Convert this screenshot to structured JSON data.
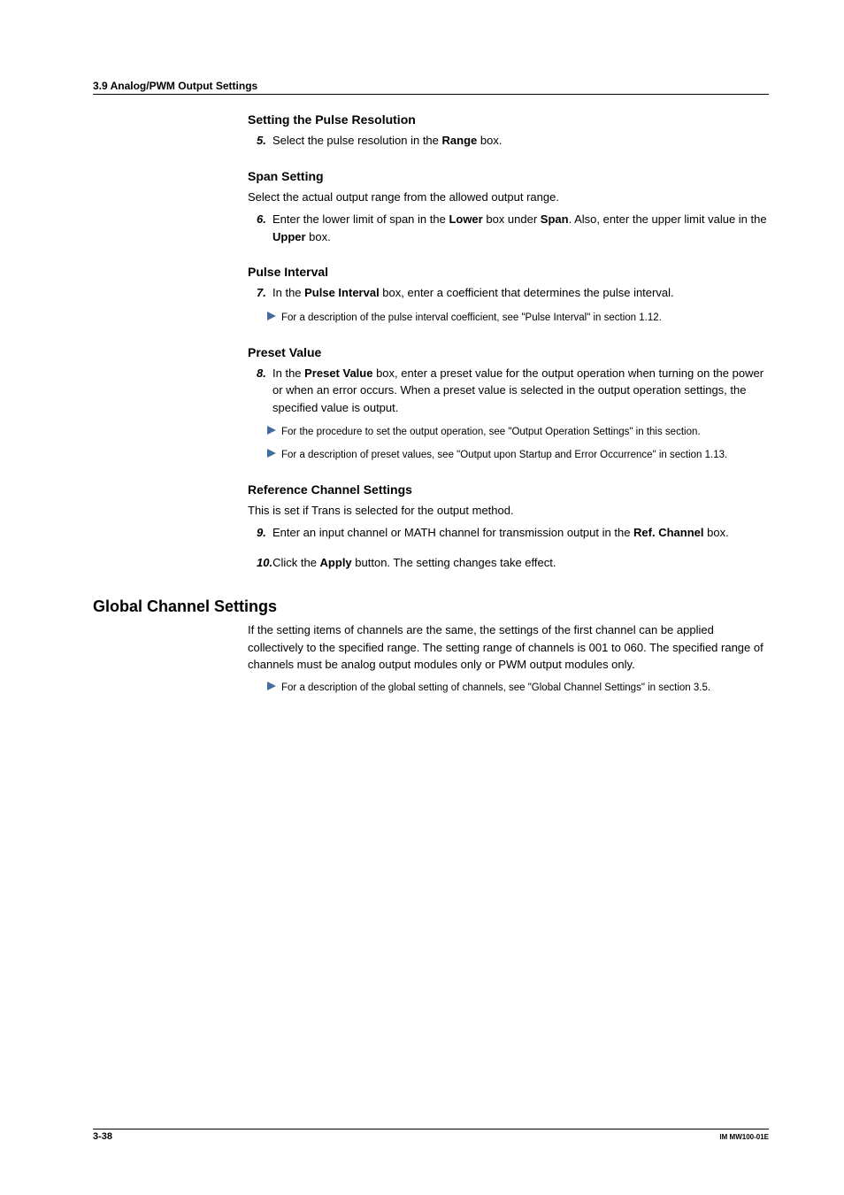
{
  "header": {
    "section_label": "3.9  Analog/PWM Output Settings"
  },
  "pulse_resolution": {
    "heading": "Setting the Pulse Resolution",
    "step_num": "5.",
    "step_text_1": "Select the pulse resolution in the ",
    "step_bold_1": "Range",
    "step_text_2": " box."
  },
  "span_setting": {
    "heading": "Span Setting",
    "intro": "Select the actual output range from the allowed output range.",
    "step_num": "6.",
    "step_text_1": "Enter the lower limit of span in the ",
    "step_bold_1": "Lower",
    "step_text_2": " box under ",
    "step_bold_2": "Span",
    "step_text_3": ". Also, enter the upper limit value in the ",
    "step_bold_3": "Upper",
    "step_text_4": " box."
  },
  "pulse_interval": {
    "heading": "Pulse Interval",
    "step_num": "7.",
    "step_text_1": "In the ",
    "step_bold_1": "Pulse Interval",
    "step_text_2": " box, enter a coefficient that determines the pulse interval.",
    "note_1": "For a description of the pulse interval coefficient, see \"Pulse Interval\" in section 1.12."
  },
  "preset_value": {
    "heading": "Preset Value",
    "step_num": "8.",
    "step_text_1": "In the ",
    "step_bold_1": "Preset Value",
    "step_text_2": " box, enter a preset value for the output operation when turning on the power or when an error occurs. When a preset value is selected in the output operation settings, the specified value is output.",
    "note_1": "For the procedure to set the output operation, see \"Output Operation Settings\" in this section.",
    "note_2": "For a description of preset values, see \"Output upon Startup and Error Occurrence\" in section 1.13."
  },
  "reference_channel": {
    "heading": "Reference Channel Settings",
    "intro": "This is set if Trans is selected for the output method.",
    "step_num_9": "9.",
    "step9_text_1": "Enter an input channel or MATH channel for transmission output in the ",
    "step9_bold_1": "Ref. Channel",
    "step9_text_2": " box.",
    "step_num_10": "10.",
    "step10_text_1": "Click the ",
    "step10_bold_1": "Apply",
    "step10_text_2": " button. The setting changes take effect."
  },
  "global_channel": {
    "heading": "Global Channel Settings",
    "intro": "If the setting items of channels are the same, the settings of the first channel can be applied collectively to the specified range. The setting range of channels is 001 to 060. The specified range of channels must be analog output modules only or PWM output modules only.",
    "note_1": "For a description of the global setting of channels, see \"Global Channel Settings\" in section 3.5."
  },
  "footer": {
    "page": "3-38",
    "doc_id": "IM MW100-01E"
  }
}
